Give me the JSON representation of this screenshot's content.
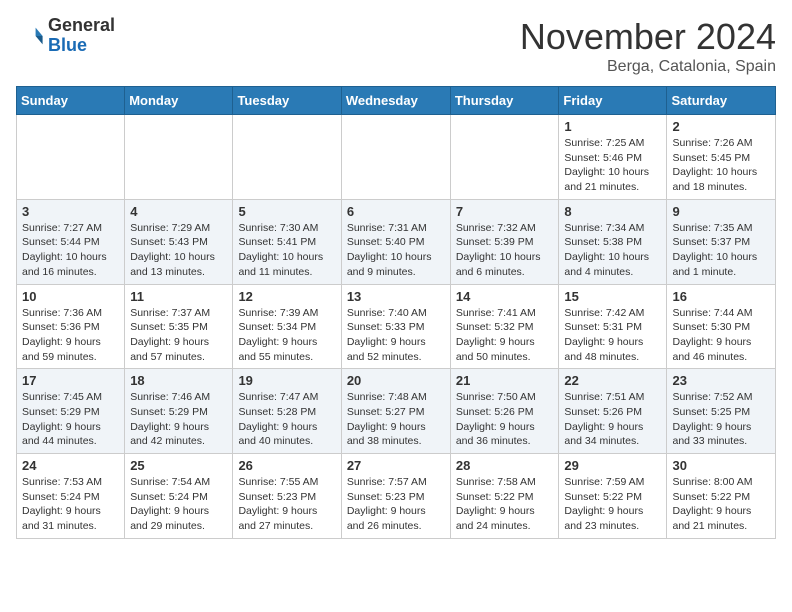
{
  "logo": {
    "general": "General",
    "blue": "Blue"
  },
  "header": {
    "month": "November 2024",
    "location": "Berga, Catalonia, Spain"
  },
  "weekdays": [
    "Sunday",
    "Monday",
    "Tuesday",
    "Wednesday",
    "Thursday",
    "Friday",
    "Saturday"
  ],
  "weeks": [
    [
      {
        "day": "",
        "info": ""
      },
      {
        "day": "",
        "info": ""
      },
      {
        "day": "",
        "info": ""
      },
      {
        "day": "",
        "info": ""
      },
      {
        "day": "",
        "info": ""
      },
      {
        "day": "1",
        "info": "Sunrise: 7:25 AM\nSunset: 5:46 PM\nDaylight: 10 hours and 21 minutes."
      },
      {
        "day": "2",
        "info": "Sunrise: 7:26 AM\nSunset: 5:45 PM\nDaylight: 10 hours and 18 minutes."
      }
    ],
    [
      {
        "day": "3",
        "info": "Sunrise: 7:27 AM\nSunset: 5:44 PM\nDaylight: 10 hours and 16 minutes."
      },
      {
        "day": "4",
        "info": "Sunrise: 7:29 AM\nSunset: 5:43 PM\nDaylight: 10 hours and 13 minutes."
      },
      {
        "day": "5",
        "info": "Sunrise: 7:30 AM\nSunset: 5:41 PM\nDaylight: 10 hours and 11 minutes."
      },
      {
        "day": "6",
        "info": "Sunrise: 7:31 AM\nSunset: 5:40 PM\nDaylight: 10 hours and 9 minutes."
      },
      {
        "day": "7",
        "info": "Sunrise: 7:32 AM\nSunset: 5:39 PM\nDaylight: 10 hours and 6 minutes."
      },
      {
        "day": "8",
        "info": "Sunrise: 7:34 AM\nSunset: 5:38 PM\nDaylight: 10 hours and 4 minutes."
      },
      {
        "day": "9",
        "info": "Sunrise: 7:35 AM\nSunset: 5:37 PM\nDaylight: 10 hours and 1 minute."
      }
    ],
    [
      {
        "day": "10",
        "info": "Sunrise: 7:36 AM\nSunset: 5:36 PM\nDaylight: 9 hours and 59 minutes."
      },
      {
        "day": "11",
        "info": "Sunrise: 7:37 AM\nSunset: 5:35 PM\nDaylight: 9 hours and 57 minutes."
      },
      {
        "day": "12",
        "info": "Sunrise: 7:39 AM\nSunset: 5:34 PM\nDaylight: 9 hours and 55 minutes."
      },
      {
        "day": "13",
        "info": "Sunrise: 7:40 AM\nSunset: 5:33 PM\nDaylight: 9 hours and 52 minutes."
      },
      {
        "day": "14",
        "info": "Sunrise: 7:41 AM\nSunset: 5:32 PM\nDaylight: 9 hours and 50 minutes."
      },
      {
        "day": "15",
        "info": "Sunrise: 7:42 AM\nSunset: 5:31 PM\nDaylight: 9 hours and 48 minutes."
      },
      {
        "day": "16",
        "info": "Sunrise: 7:44 AM\nSunset: 5:30 PM\nDaylight: 9 hours and 46 minutes."
      }
    ],
    [
      {
        "day": "17",
        "info": "Sunrise: 7:45 AM\nSunset: 5:29 PM\nDaylight: 9 hours and 44 minutes."
      },
      {
        "day": "18",
        "info": "Sunrise: 7:46 AM\nSunset: 5:29 PM\nDaylight: 9 hours and 42 minutes."
      },
      {
        "day": "19",
        "info": "Sunrise: 7:47 AM\nSunset: 5:28 PM\nDaylight: 9 hours and 40 minutes."
      },
      {
        "day": "20",
        "info": "Sunrise: 7:48 AM\nSunset: 5:27 PM\nDaylight: 9 hours and 38 minutes."
      },
      {
        "day": "21",
        "info": "Sunrise: 7:50 AM\nSunset: 5:26 PM\nDaylight: 9 hours and 36 minutes."
      },
      {
        "day": "22",
        "info": "Sunrise: 7:51 AM\nSunset: 5:26 PM\nDaylight: 9 hours and 34 minutes."
      },
      {
        "day": "23",
        "info": "Sunrise: 7:52 AM\nSunset: 5:25 PM\nDaylight: 9 hours and 33 minutes."
      }
    ],
    [
      {
        "day": "24",
        "info": "Sunrise: 7:53 AM\nSunset: 5:24 PM\nDaylight: 9 hours and 31 minutes."
      },
      {
        "day": "25",
        "info": "Sunrise: 7:54 AM\nSunset: 5:24 PM\nDaylight: 9 hours and 29 minutes."
      },
      {
        "day": "26",
        "info": "Sunrise: 7:55 AM\nSunset: 5:23 PM\nDaylight: 9 hours and 27 minutes."
      },
      {
        "day": "27",
        "info": "Sunrise: 7:57 AM\nSunset: 5:23 PM\nDaylight: 9 hours and 26 minutes."
      },
      {
        "day": "28",
        "info": "Sunrise: 7:58 AM\nSunset: 5:22 PM\nDaylight: 9 hours and 24 minutes."
      },
      {
        "day": "29",
        "info": "Sunrise: 7:59 AM\nSunset: 5:22 PM\nDaylight: 9 hours and 23 minutes."
      },
      {
        "day": "30",
        "info": "Sunrise: 8:00 AM\nSunset: 5:22 PM\nDaylight: 9 hours and 21 minutes."
      }
    ]
  ]
}
